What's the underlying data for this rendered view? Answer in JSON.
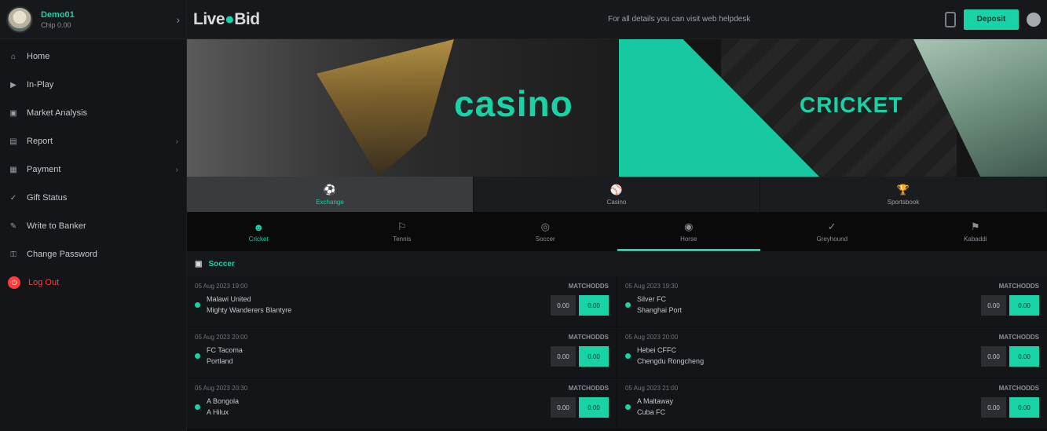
{
  "profile": {
    "name": "Demo01",
    "balance": "Chip 0.00"
  },
  "sidebar": {
    "items": [
      {
        "icon": "⌂",
        "label": "Home",
        "arrow": ""
      },
      {
        "icon": "▶",
        "label": "In-Play",
        "arrow": ""
      },
      {
        "icon": "▣",
        "label": "Market Analysis",
        "arrow": ""
      },
      {
        "icon": "▤",
        "label": "Report",
        "arrow": "›"
      },
      {
        "icon": "▦",
        "label": "Payment",
        "arrow": "›"
      },
      {
        "icon": "✓",
        "label": "Gift Status",
        "arrow": ""
      },
      {
        "icon": "✎",
        "label": "Write to Banker",
        "arrow": ""
      },
      {
        "icon": "⚿",
        "label": "Change Password",
        "arrow": ""
      },
      {
        "icon": "⏻",
        "label": "Log Out",
        "arrow": ""
      }
    ]
  },
  "header": {
    "logo_left": "Live",
    "logo_mid": "●",
    "logo_right": "Bid",
    "marquee": "For all details you can visit web helpdesk",
    "deposit_label": "Deposit"
  },
  "banner": {
    "casino_text": "casino",
    "cricket_text": "CRICKET"
  },
  "sport_tabs": [
    {
      "icon": "⚽",
      "label": "Exchange"
    },
    {
      "icon": "⚾",
      "label": "Casino"
    },
    {
      "icon": "🏆",
      "label": "Sportsbook"
    }
  ],
  "nav_tabs": [
    {
      "icon": "☻",
      "label": "Cricket"
    },
    {
      "icon": "⚐",
      "label": "Tennis"
    },
    {
      "icon": "◎",
      "label": "Soccer"
    },
    {
      "icon": "◉",
      "label": "Horse"
    },
    {
      "icon": "✓",
      "label": "Greyhound"
    },
    {
      "icon": "⚑",
      "label": "Kabaddi"
    }
  ],
  "section": {
    "icon": "▣",
    "title": "Soccer"
  },
  "matches": [
    {
      "date": "05 Aug 2023 19:00",
      "team1": "Malawi United",
      "team2": "Mighty Wanderers Blantyre",
      "odds_label": "MATCHODDS",
      "back": "0.00",
      "lay": "0.00"
    },
    {
      "date": "05 Aug 2023 19:30",
      "team1": "Silver FC",
      "team2": "Shanghai Port",
      "odds_label": "MATCHODDS",
      "back": "0.00",
      "lay": "0.00"
    },
    {
      "date": "05 Aug 2023 20:00",
      "team1": "FC Tacoma",
      "team2": "Portland",
      "odds_label": "MATCHODDS",
      "back": "0.00",
      "lay": "0.00"
    },
    {
      "date": "05 Aug 2023 20:00",
      "team1": "Hebei CFFC",
      "team2": "Chengdu Rongcheng",
      "odds_label": "MATCHODDS",
      "back": "0.00",
      "lay": "0.00"
    },
    {
      "date": "05 Aug 2023 20:30",
      "team1": "A Bongola",
      "team2": "A Hilux",
      "odds_label": "MATCHODDS",
      "back": "0.00",
      "lay": "0.00"
    },
    {
      "date": "05 Aug 2023 21:00",
      "team1": "A Maltaway",
      "team2": "Cuba FC",
      "odds_label": "MATCHODDS",
      "back": "0.00",
      "lay": "0.00"
    }
  ],
  "colors": {
    "accent": "#19d3a6",
    "danger": "#ff3b3b",
    "background": "#111214"
  }
}
